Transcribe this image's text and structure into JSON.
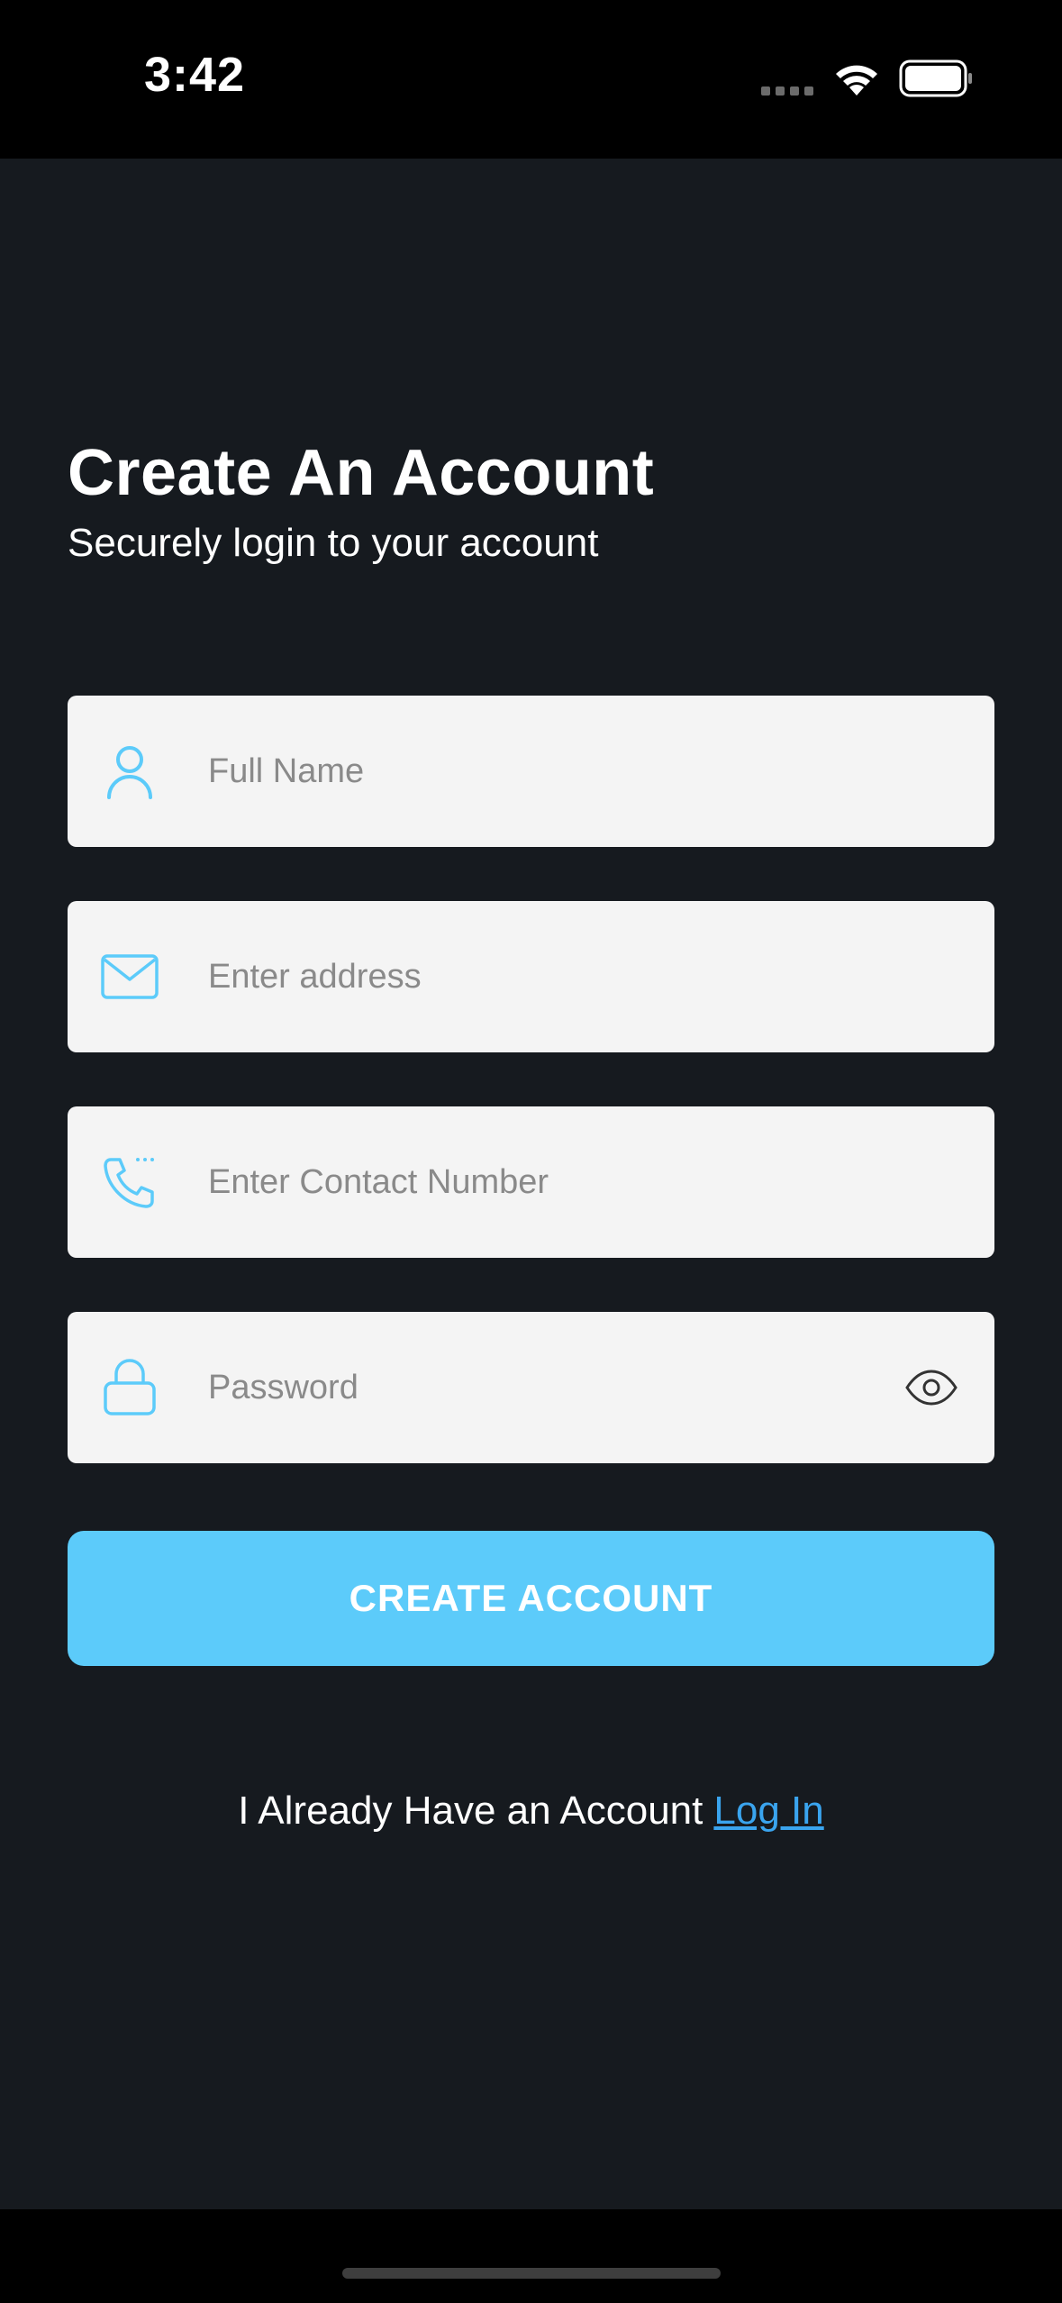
{
  "status_bar": {
    "time": "3:42"
  },
  "header": {
    "title": "Create An Account",
    "subtitle": "Securely login to your account"
  },
  "form": {
    "full_name": {
      "placeholder": "Full Name",
      "value": "",
      "icon": "person-icon"
    },
    "address": {
      "placeholder": "Enter address",
      "value": "",
      "icon": "mail-icon"
    },
    "contact": {
      "placeholder": "Enter Contact Number",
      "value": "",
      "icon": "phone-icon"
    },
    "password": {
      "placeholder": "Password",
      "value": "",
      "icon": "lock-icon",
      "toggle_icon": "eye-icon"
    },
    "submit_label": "CREATE ACCOUNT"
  },
  "footer": {
    "prompt": "I Already Have an Account",
    "login_label": "Log In"
  },
  "colors": {
    "background": "#161a1f",
    "accent": "#5ccbfa",
    "link": "#3aa4ee",
    "field_bg": "#f4f4f4"
  }
}
